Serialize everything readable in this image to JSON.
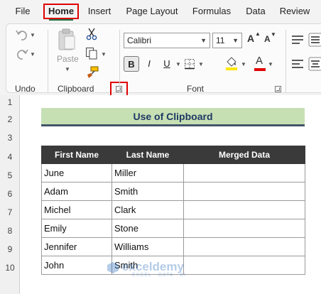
{
  "tabs": [
    {
      "label": "File"
    },
    {
      "label": "Home"
    },
    {
      "label": "Insert"
    },
    {
      "label": "Page Layout"
    },
    {
      "label": "Formulas"
    },
    {
      "label": "Data"
    },
    {
      "label": "Review"
    }
  ],
  "ribbon": {
    "groups": {
      "undo": "Undo",
      "clipboard": "Clipboard",
      "font": "Font"
    },
    "paste_label": "Paste",
    "font_name": "Calibri",
    "font_size": "11",
    "bold_label": "B",
    "italic_label": "I",
    "underline_label": "U",
    "grow_font_label": "A",
    "shrink_font_label": "A",
    "font_color_label": "A",
    "colors": {
      "active_tab_outline": "#e00000",
      "excel_green": "#1e7145",
      "highlight_yellow": "#ffe600",
      "font_color_red": "#e00000"
    }
  },
  "sheet": {
    "row_numbers": [
      "1",
      "2",
      "3",
      "4",
      "5",
      "6",
      "7",
      "8",
      "9",
      "10"
    ],
    "title": "Use of Clipboard",
    "headers": [
      "First Name",
      "Last Name",
      "Merged Data"
    ],
    "rows": [
      [
        "June",
        "Miller",
        ""
      ],
      [
        "Adam",
        "Smith",
        ""
      ],
      [
        "Michel",
        "Clark",
        ""
      ],
      [
        "Emily",
        "Stone",
        ""
      ],
      [
        "Jennifer",
        "Williams",
        ""
      ],
      [
        "John",
        "Smith",
        ""
      ]
    ],
    "title_fill": "#c6e0b4",
    "header_fill": "#3a3a3a"
  },
  "watermark": {
    "name": "exceldemy",
    "tagline": "EXCEL · DATA · BI"
  }
}
